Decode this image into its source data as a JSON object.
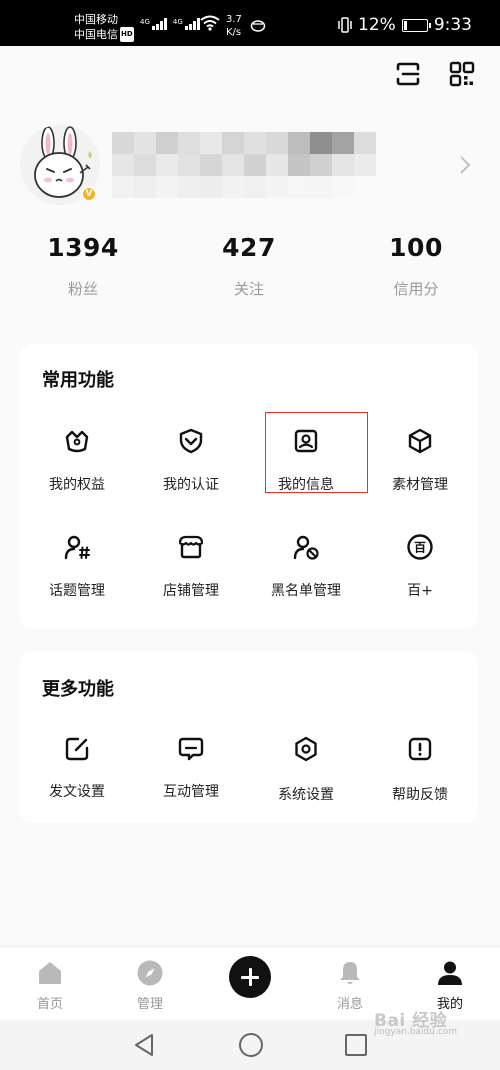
{
  "status_bar": {
    "carrier_1": "中国移动",
    "carrier_2": "中国电信",
    "hd_tag": "HD",
    "network_1": "4G",
    "network_2": "4G",
    "speed_value": "3.7",
    "speed_unit": "K/s",
    "battery_text": "12%",
    "battery_level": 0.12,
    "time": "9:33"
  },
  "header": {
    "icons": [
      "scan-icon",
      "qr-code-icon"
    ]
  },
  "profile": {
    "verified_badge": "V"
  },
  "stats": [
    {
      "value": "1394",
      "label": "粉丝"
    },
    {
      "value": "427",
      "label": "关注"
    },
    {
      "value": "100",
      "label": "信用分"
    }
  ],
  "common_functions": {
    "title": "常用功能",
    "items": [
      {
        "label": "我的权益",
        "icon": "crown-icon"
      },
      {
        "label": "我的认证",
        "icon": "verify-icon"
      },
      {
        "label": "我的信息",
        "icon": "profile-card-icon"
      },
      {
        "label": "素材管理",
        "icon": "cube-icon"
      },
      {
        "label": "话题管理",
        "icon": "topic-icon"
      },
      {
        "label": "店铺管理",
        "icon": "shop-icon"
      },
      {
        "label": "黑名单管理",
        "icon": "blacklist-icon"
      },
      {
        "label": "百+",
        "icon": "bai-icon"
      }
    ],
    "bai_glyph": "百"
  },
  "more_functions": {
    "title": "更多功能",
    "items": [
      {
        "label": "发文设置",
        "icon": "edit-icon"
      },
      {
        "label": "互动管理",
        "icon": "chat-icon"
      },
      {
        "label": "系统设置",
        "icon": "settings-icon"
      },
      {
        "label": "帮助反馈",
        "icon": "feedback-icon"
      }
    ]
  },
  "tabbar": {
    "tabs": [
      {
        "label": "首页",
        "icon": "home-icon"
      },
      {
        "label": "管理",
        "icon": "compass-icon"
      },
      {
        "label": "",
        "icon": "plus-icon"
      },
      {
        "label": "消息",
        "icon": "bell-icon"
      },
      {
        "label": "我的",
        "icon": "user-icon"
      }
    ],
    "active": "我的"
  },
  "watermark": {
    "line1": "Bai 经验",
    "line2": "jingyan.baidu.com"
  }
}
